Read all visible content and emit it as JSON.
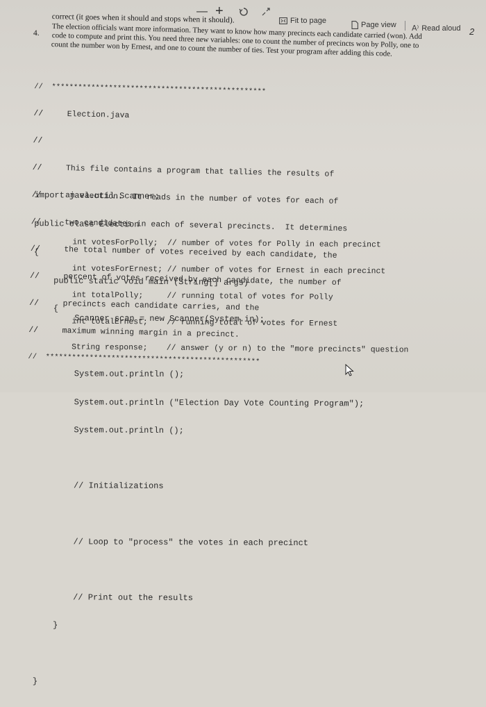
{
  "toolbar": {
    "minus": "—",
    "plus": "+",
    "fit_to_page": "Fit to page",
    "page_view": "Page view",
    "read_aloud": "Read aloud",
    "more_glyph": "2"
  },
  "instructions": {
    "line0": "correct (it goes when it should and stops when it should).",
    "number": "4.",
    "line1": "The election officials want more information. They want to know how many precincts each candidate carried (won). Add",
    "line2": "code to compute and print this. You need three new variables: one to count the number of precincts won by Polly, one to",
    "line3": "count the number won by Ernest, and one to count the number of ties. Test your program after adding this code."
  },
  "code": {
    "lines": [
      "//  *************************************************",
      "//     Election.java",
      "//",
      "//     This file contains a program that tallies the results of",
      "//     an election.  It reads in the number of votes for each of",
      "//     two candidates in each of several precincts.  It determines",
      "//     the total number of votes received by each candidate, the",
      "//     percent of votes received by each candidate, the number of",
      "//     precincts each candidate carries, and the",
      "//     maximum winning margin in a precinct.",
      "//  *************************************************",
      "import java.util.Scanner;",
      "public class Election",
      "{",
      "    public static void main (String[] args)",
      "    {",
      "        int votesForPolly;  // number of votes for Polly in each precinct",
      "        int votesForErnest; // number of votes for Ernest in each precinct",
      "        int totalPolly;     // running total of votes for Polly",
      "        int totalErnest;    // running total of votes for Ernest",
      "        String response;    // answer (y or n) to the \"more precincts\" question",
      "",
      "        Scanner scan = new Scanner(System.in);",
      "",
      "        System.out.println ();",
      "        System.out.println (\"Election Day Vote Counting Program\");",
      "        System.out.println ();",
      "",
      "        // Initializations",
      "",
      "        // Loop to \"process\" the votes in each precinct",
      "",
      "        // Print out the results",
      "    }",
      "",
      "}"
    ]
  }
}
